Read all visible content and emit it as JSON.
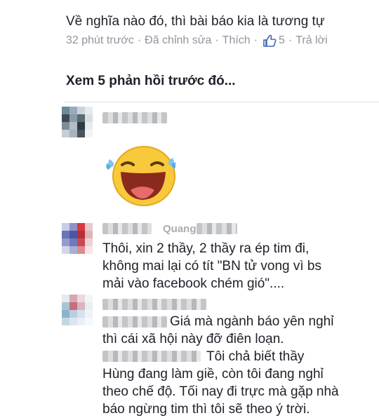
{
  "top_comment": {
    "text": "Về nghĩa nào đó, thì bài báo kia là tương tự",
    "time": "32 phút trước",
    "edited": "Đã chỉnh sửa",
    "like": "Thích",
    "like_count": "5",
    "reply": "Trả lời",
    "separator": "·"
  },
  "view_previous": "Xem 5 phản hồi trước đó...",
  "replies": [
    {
      "name_visible": "",
      "emoji": "laughing-tears"
    },
    {
      "name_visible": "Quang",
      "lines": [
        "Thôi, xin 2 thầy, 2 thầy ra ép tim đi,",
        "không mai lại có tít \"BN tử vong vì bs",
        "mải vào facebook chém gió\"...."
      ]
    },
    {
      "name_visible": "",
      "lines": [
        "Giá mà ngành báo yên nghỉ",
        "thì cái xã hội này đỡ điên loạn.",
        "Tôi chả biết thầy",
        "Hùng đang làm giề, còn tôi đang nghỉ",
        "theo chế độ. Tối nay đi trực mà gặp nhà",
        "báo ngừng tim thì tôi sẽ theo ý trời."
      ]
    }
  ],
  "colors": {
    "meta": "#90949c",
    "text": "#1d2129",
    "emoji_face": "#f8c93b"
  },
  "icons": {
    "like": "thumbs-up-icon"
  }
}
